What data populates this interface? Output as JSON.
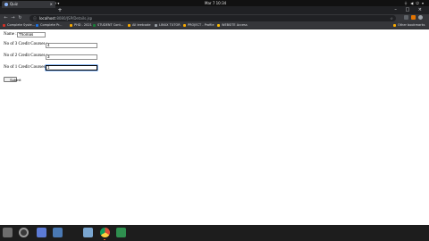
{
  "topbar": {
    "activities": "Activities",
    "app_menu": "Google Chrome ▾",
    "clock": "Mar 7 10:34",
    "system": "⏚ ◀ ⏻ ▾"
  },
  "browser": {
    "tab_title": "Quiz",
    "tab_close": "×",
    "new_tab": "+",
    "window_controls": "– □ ×",
    "url_info": "ⓘ",
    "url_host": "localhost",
    "url_rest": ":8080/JSP/Details.jsp",
    "bookmarks": [
      {
        "label": "Complete Syste...",
        "color": "#d93025"
      },
      {
        "label": "Complete Pr...",
        "color": "#1a73e8"
      },
      {
        "label": "PHD - 2021",
        "color": "#f9ab00"
      },
      {
        "label": "STUDENT Cont...",
        "color": "#188038"
      },
      {
        "label": "All leetcode",
        "color": "#f9ab00"
      },
      {
        "label": "LINUX TUTOR",
        "color": "#9aa0a6"
      },
      {
        "label": "PROJECT - Profile",
        "color": "#f9ab00"
      },
      {
        "label": "WEBSITE Access",
        "color": "#fbbc04"
      },
      {
        "label": "Other bookmarks",
        "color": "#f9ab00"
      }
    ]
  },
  "form": {
    "name_label": "Name :",
    "name_value": "Thomas",
    "credit3_label": "No of 3 Credit Courses :",
    "credit3_value": "4",
    "credit2_label": "No of 2 Credit Courses :",
    "credit2_value": "3",
    "credit1_label": "No of 1 Credit Courses :",
    "credit1_value": "1",
    "submit_label": "Submit"
  },
  "dock": {
    "apps": [
      {
        "name": "files",
        "color": "#6d6d6d"
      },
      {
        "name": "camera",
        "color": "#3a3a3a"
      },
      {
        "name": "calendar",
        "color": "#5c7bd6"
      },
      {
        "name": "text-editor",
        "color": "#4a79b4"
      },
      {
        "name": "software",
        "color": "#7aa6d0"
      },
      {
        "name": "chrome",
        "color": "#dd4b39"
      },
      {
        "name": "app",
        "color": "#2f8f4f"
      }
    ]
  }
}
